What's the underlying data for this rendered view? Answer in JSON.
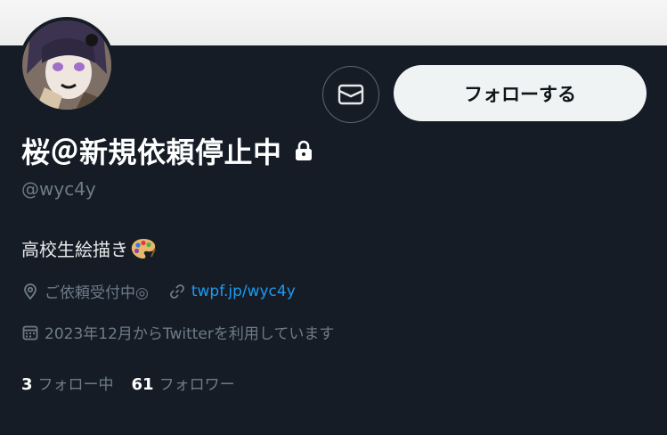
{
  "profile": {
    "display_name": "桜＠新規依頼停止中",
    "handle": "@wyc4y",
    "bio": "高校生絵描き",
    "location": "ご依頼受付中◎",
    "website": "twpf.jp/wyc4y",
    "joined": "2023年12月からTwitterを利用しています",
    "protected_icon": "lock-icon",
    "bio_emoji": "artist-palette-icon"
  },
  "actions": {
    "follow_label": "フォローする",
    "message_icon": "envelope-icon"
  },
  "stats": {
    "following_count": "3",
    "following_label": "フォロー中",
    "followers_count": "61",
    "followers_label": "フォロワー"
  },
  "colors": {
    "background": "#151c26",
    "link": "#1d9bf0",
    "muted": "#6e7b88",
    "follow_button_bg": "#eff3f4"
  }
}
